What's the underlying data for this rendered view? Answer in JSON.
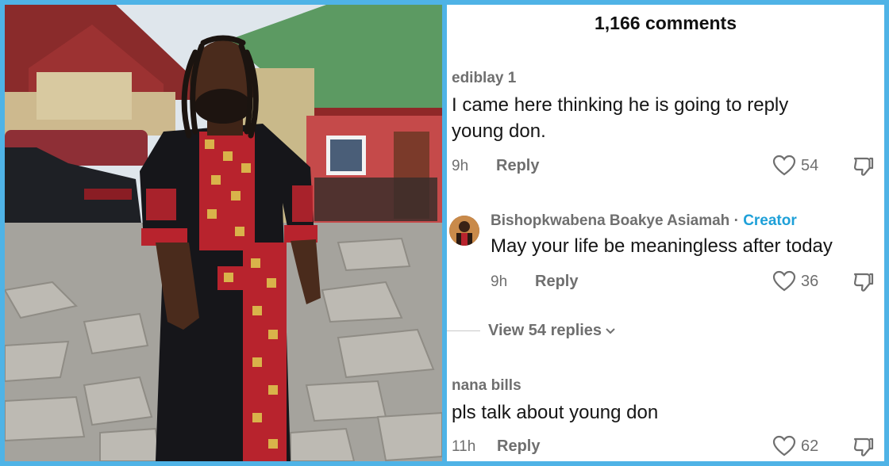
{
  "comments_header": {
    "count_label": "1,166 comments"
  },
  "comments": [
    {
      "username": "ediblay 1",
      "text_line1": "I came here thinking he is going to reply",
      "text_line2": "young don.",
      "time": "9h",
      "reply_label": "Reply",
      "likes": "54"
    },
    {
      "username": "Bishopkwabena Boakye Asiamah",
      "separator": " · ",
      "badge": "Creator",
      "text_line1": "May your life be meaningless after today",
      "time": "9h",
      "reply_label": "Reply",
      "likes": "36"
    },
    {
      "username": "nana bills",
      "text_line1": "pls talk about young don",
      "time": "11h",
      "reply_label": "Reply",
      "likes": "62"
    }
  ],
  "view_replies": {
    "label": "View 54 replies"
  },
  "icons": {
    "like": "heart-outline-icon",
    "dislike": "thumbs-down-outline-icon",
    "expand": "chevron-down-icon"
  },
  "colors": {
    "frame": "#4fb3e6",
    "creator_badge": "#1ea0d8",
    "secondary_text": "#6f6f6f"
  }
}
